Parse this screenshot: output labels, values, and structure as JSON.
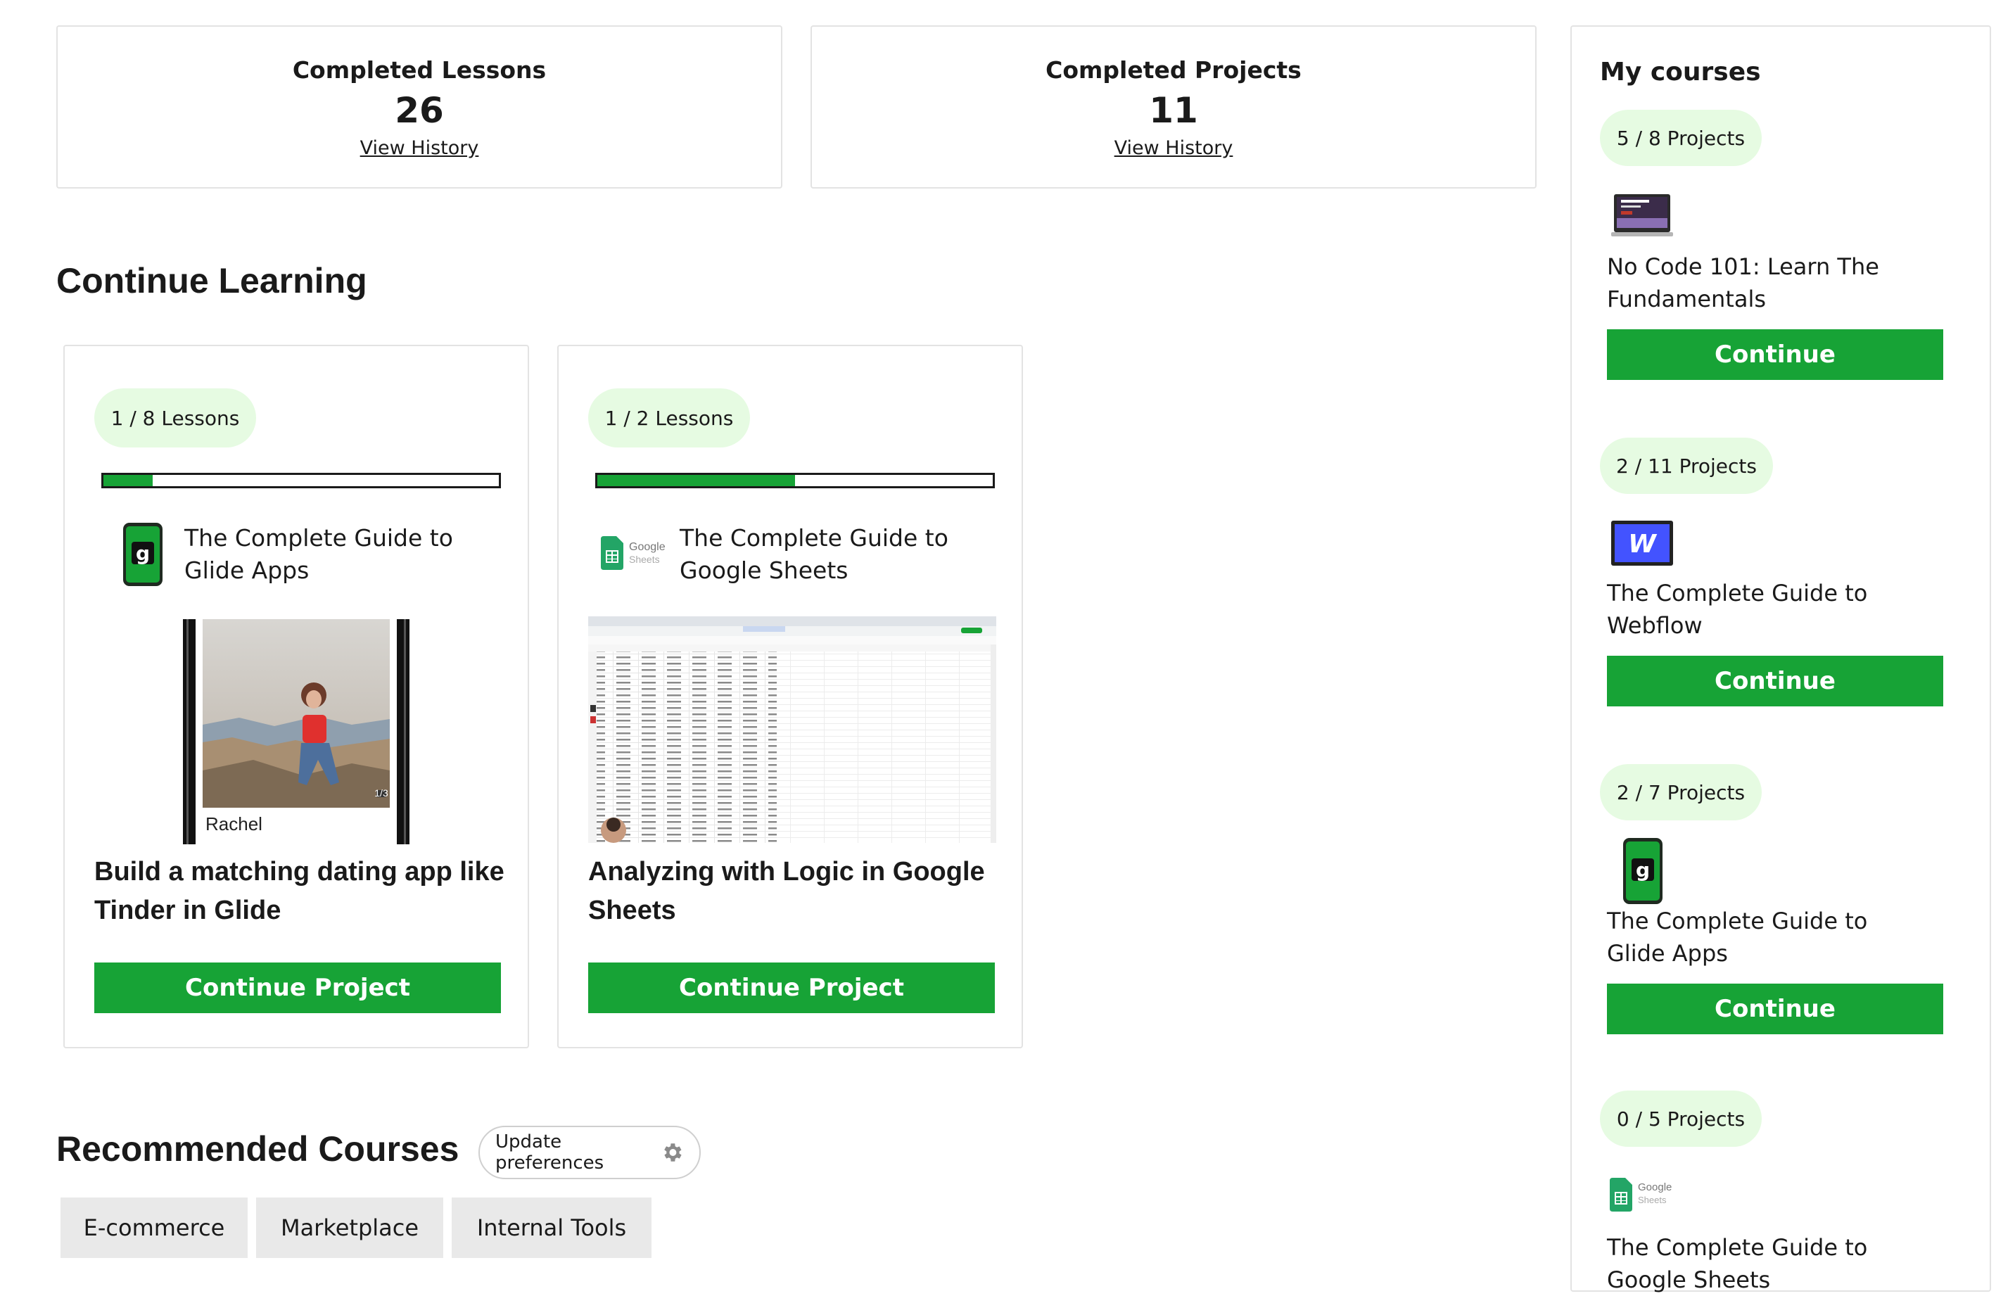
{
  "stats": [
    {
      "title": "Completed Lessons",
      "value": "26",
      "link": "View History"
    },
    {
      "title": "Completed Projects",
      "value": "11",
      "link": "View History"
    }
  ],
  "continue_learning": {
    "title": "Continue Learning",
    "cards": [
      {
        "pill": "1 / 8 Lessons",
        "progress": 0.125,
        "course": [
          "The Complete Guide to",
          "Glide Apps"
        ],
        "preview_name": "Rachel",
        "preview_counter": "1/3",
        "project_title": "Build a matching dating app like Tinder in Glide",
        "button": "Continue Project"
      },
      {
        "pill": "1 / 2 Lessons",
        "progress": 0.5,
        "course": [
          "The Complete Guide to",
          "Google Sheets"
        ],
        "project_title": "Analyzing with Logic in Google Sheets",
        "button": "Continue Project"
      }
    ]
  },
  "recommended": {
    "title": "Recommended Courses",
    "preferences_button": "Update preferences",
    "chips": [
      "E-commerce",
      "Marketplace",
      "Internal Tools"
    ]
  },
  "sidebar": {
    "title": "My courses",
    "courses": [
      {
        "pill": "5 / 8 Projects",
        "icon": "laptop-thumbnail-icon",
        "name": [
          "No Code 101: Learn The",
          "Fundamentals"
        ],
        "button": "Continue"
      },
      {
        "pill": "2 / 11 Projects",
        "icon": "webflow-icon",
        "icon_letter": "W",
        "name": [
          "The Complete Guide to",
          "Webflow"
        ],
        "button": "Continue"
      },
      {
        "pill": "2 / 7 Projects",
        "icon": "glide-icon",
        "icon_letter": "g",
        "name": [
          "The Complete Guide to",
          "Glide Apps"
        ],
        "button": "Continue"
      },
      {
        "pill": "0 / 5 Projects",
        "icon": "google-sheets-icon",
        "name": [
          "The Complete Guide to",
          "Google Sheets"
        ]
      }
    ]
  },
  "icons": {
    "google_word": "Google",
    "sheets_word": "Sheets",
    "glide_letter": "g"
  },
  "colors": {
    "accent": "#17a336",
    "pill_bg": "#e6fbe2",
    "chip_bg": "#e9e9e9",
    "border": "#e3e3e3"
  }
}
